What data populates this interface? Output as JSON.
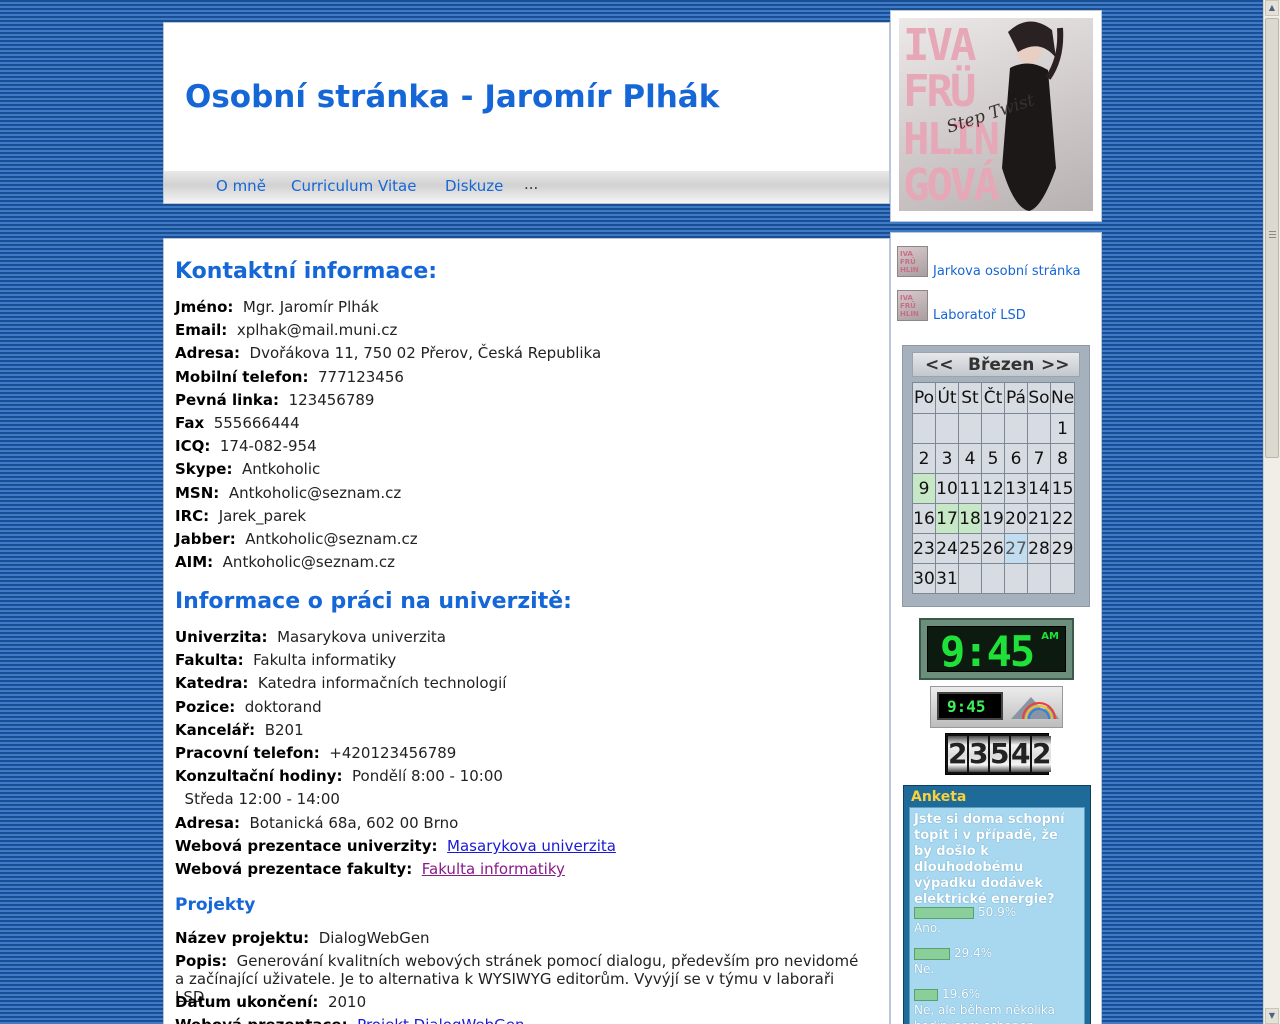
{
  "header": {
    "title": "Osobní stránka - Jaromír Plhák",
    "nav": [
      {
        "label": "O mně"
      },
      {
        "label": "Curriculum Vitae"
      },
      {
        "label": "Diskuze"
      }
    ],
    "nav_more": "..."
  },
  "photo": {
    "text_lines": [
      "IVA",
      "FRÜ",
      "HLIN",
      "GOVÁ"
    ],
    "script": "Step Twist"
  },
  "contact": {
    "heading": "Kontaktní informace:",
    "rows": [
      {
        "key": "Jméno:",
        "value": "Mgr. Jaromír Plhák"
      },
      {
        "key": "Email:",
        "value": "xplhak@mail.muni.cz"
      },
      {
        "key": "Adresa:",
        "value": "Dvořákova 11, 750 02 Přerov, Česká Republika"
      },
      {
        "key": "Mobilní telefon:",
        "value": "777123456"
      },
      {
        "key": "Pevná linka:",
        "value": "123456789"
      },
      {
        "key": "Fax",
        "value": "555666444"
      },
      {
        "key": "ICQ:",
        "value": "174-082-954"
      },
      {
        "key": "Skype:",
        "value": "Antkoholic"
      },
      {
        "key": "MSN:",
        "value": "Antkoholic@seznam.cz"
      },
      {
        "key": "IRC:",
        "value": "Jarek_parek"
      },
      {
        "key": "Jabber:",
        "value": "Antkoholic@seznam.cz"
      },
      {
        "key": "AIM:",
        "value": "Antkoholic@seznam.cz"
      }
    ]
  },
  "university": {
    "heading": "Informace o práci na univerzitě:",
    "rows": [
      {
        "key": "Univerzita:",
        "value": "Masarykova univerzita"
      },
      {
        "key": "Fakulta:",
        "value": "Fakulta informatiky"
      },
      {
        "key": "Katedra:",
        "value": "Katedra informačních technologií"
      },
      {
        "key": "Pozice:",
        "value": "doktorand"
      },
      {
        "key": "Kancelář:",
        "value": "B201"
      },
      {
        "key": "Pracovní telefon:",
        "value": "+420123456789"
      },
      {
        "key": "Konzultační hodiny:",
        "value": "Pondělí 8:00 - 10:00"
      },
      {
        "key": "",
        "value": "Středa 12:00 - 14:00"
      },
      {
        "key": "Adresa:",
        "value": "Botanická 68a, 602 00 Brno"
      }
    ],
    "web_uni": {
      "key": "Webová prezentace univerzity:",
      "link": "Masarykova univerzita"
    },
    "web_fac": {
      "key": "Webová prezentace fakulty:",
      "link": "Fakulta informatiky"
    }
  },
  "projects": {
    "heading": "Projekty",
    "name": {
      "key": "Název projektu:",
      "value": "DialogWebGen"
    },
    "desc": {
      "key": "Popis:",
      "value": "Generování kvalitních webových stránek pomocí dialogu, především pro nevidomé a začínající uživatele. Je to alternativa k WYSIWYG editorům. Vyvýjí se v týmu v laboraři LSD."
    },
    "end": {
      "key": "Datum ukončení:",
      "value": "2010"
    },
    "web": {
      "key": "Webová prezentace:",
      "link": "Projekt DialogWebGen"
    }
  },
  "sidebar": {
    "links": [
      {
        "label": "Jarkova osobní stránka"
      },
      {
        "label": "Laboratoř LSD"
      }
    ]
  },
  "calendar": {
    "prev": "<<",
    "month": "Březen",
    "next": ">>",
    "weekdays": [
      "Po",
      "Út",
      "St",
      "Čt",
      "Pá",
      "So",
      "Ne"
    ],
    "weeks": [
      [
        "",
        "",
        "",
        "",
        "",
        "",
        "1"
      ],
      [
        "2",
        "3",
        "4",
        "5",
        "6",
        "7",
        "8"
      ],
      [
        "9",
        "10",
        "11",
        "12",
        "13",
        "14",
        "15"
      ],
      [
        "16",
        "17",
        "18",
        "19",
        "20",
        "21",
        "22"
      ],
      [
        "23",
        "24",
        "25",
        "26",
        "27",
        "28",
        "29"
      ],
      [
        "30",
        "31",
        "",
        "",
        "",
        "",
        ""
      ]
    ],
    "highlighted": [
      "9",
      "17",
      "18"
    ],
    "today": "27"
  },
  "clock_big": {
    "time": "9:45",
    "ampm": "AM"
  },
  "clock_small": {
    "time": "9:45"
  },
  "counter": {
    "digits": [
      "2",
      "3",
      "5",
      "4",
      "2"
    ]
  },
  "poll": {
    "title": "Anketa",
    "question": "Jste si doma schopní topit i v případě, že by došlo k dlouhodobému výpadku dodávek elektrické energie?",
    "answers": [
      {
        "percent": "50.9%",
        "fraction": 0.509,
        "label": "Ano."
      },
      {
        "percent": "29.4%",
        "fraction": 0.294,
        "label": "Ne."
      },
      {
        "percent": "19.6%",
        "fraction": 0.196,
        "label": "Ne, ale během několika hodin jsem schopen (schopna)"
      }
    ]
  }
}
